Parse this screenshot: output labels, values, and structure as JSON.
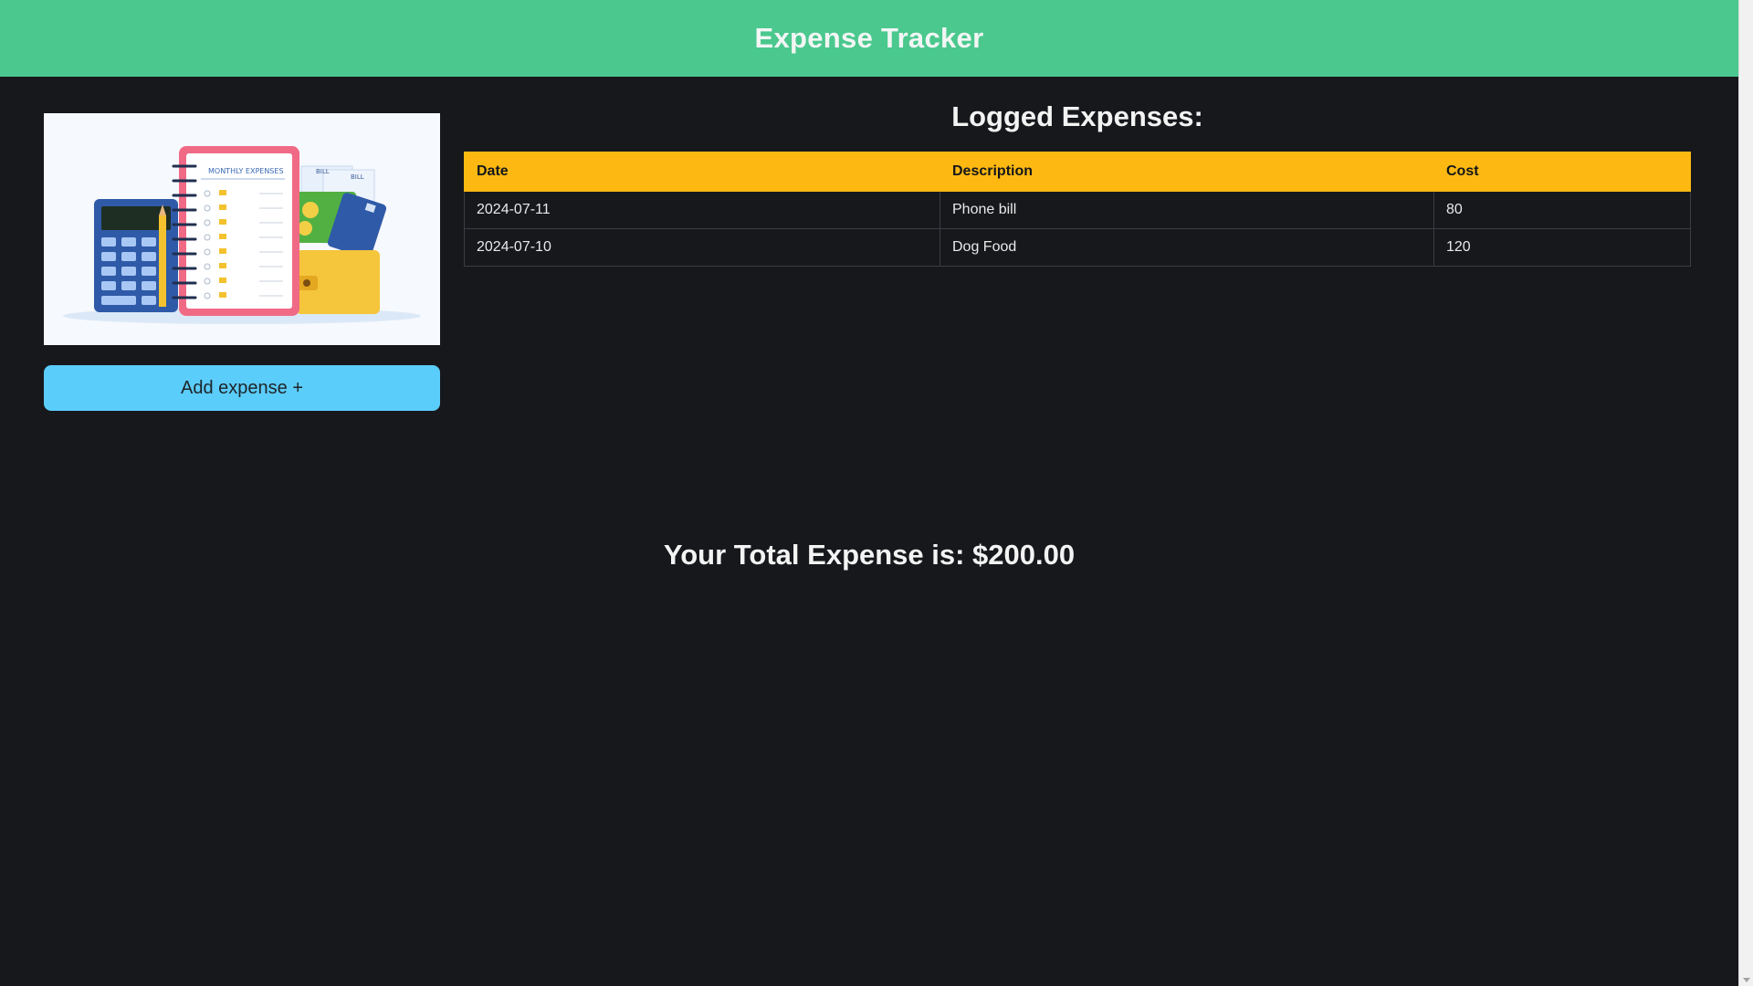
{
  "header": {
    "title": "Expense Tracker"
  },
  "sidebar": {
    "image_alt": "Monthly expenses illustration",
    "image_text": {
      "notebook_title": "MONTHLY EXPENSES",
      "bill_1": "BILL",
      "bill_2": "BILL"
    },
    "add_button_label": "Add expense +"
  },
  "expenses": {
    "title": "Logged Expenses:",
    "columns": [
      "Date",
      "Description",
      "Cost"
    ],
    "rows": [
      {
        "date": "2024-07-11",
        "description": "Phone bill",
        "cost": "80"
      },
      {
        "date": "2024-07-10",
        "description": "Dog Food",
        "cost": "120"
      }
    ]
  },
  "total": {
    "text": "Your Total Expense is: $200.00"
  },
  "colors": {
    "header_bg": "#4ac88e",
    "page_bg": "#17181c",
    "table_header_bg": "#fdb912",
    "button_bg": "#5bcdfa"
  }
}
